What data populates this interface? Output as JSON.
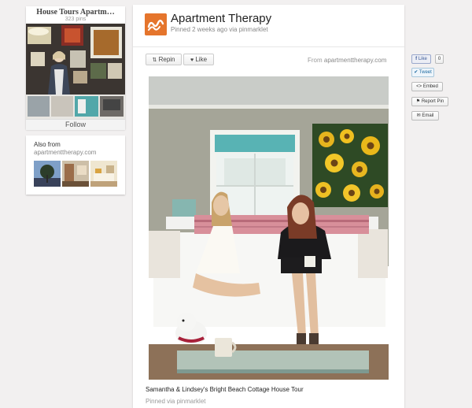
{
  "board": {
    "title": "House Tours Apartm…",
    "pins": "323 pins",
    "follow_label": "Follow"
  },
  "also_from": {
    "label": "Also from",
    "domain": "apartmenttherapy.com"
  },
  "pin": {
    "source_name": "Apartment Therapy",
    "meta": "Pinned 2 weeks ago via pinmarklet",
    "repin_label": "Repin",
    "like_label": "Like",
    "from_prefix": "From",
    "from_domain": "apartmenttherapy.com",
    "description": "Samantha & Lindsey's Bright Beach Cottage House Tour",
    "pinned_via": "Pinned via pinmarklet"
  },
  "share": {
    "fb_like": "Like",
    "fb_count": "0",
    "tweet": "Tweet",
    "embed": "Embed",
    "report": "Report Pin",
    "email": "Email"
  },
  "colors": {
    "accent": "#e5752c",
    "background": "#f2f0f0"
  },
  "icons": [
    "repin-icon",
    "heart-icon",
    "twitter-icon",
    "embed-icon",
    "flag-icon",
    "email-icon",
    "apartment-therapy-logo"
  ]
}
